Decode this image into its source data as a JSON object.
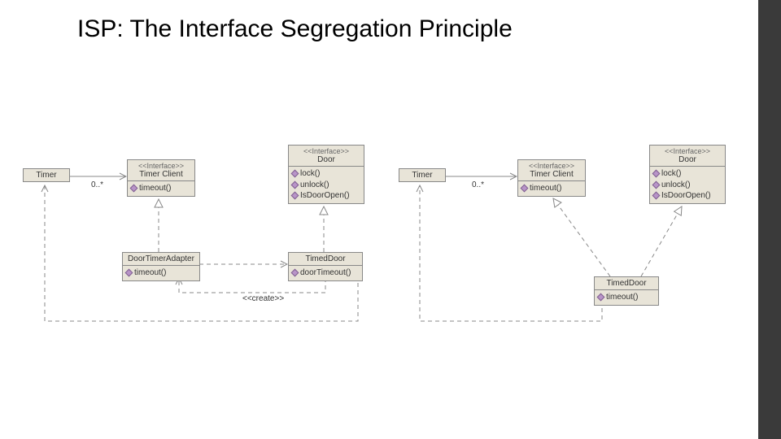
{
  "slide": {
    "title": "ISP: The Interface Segregation Principle"
  },
  "labels": {
    "mult_left": "0..*",
    "mult_right": "0..*",
    "create": "<<create>>"
  },
  "boxes": {
    "timer_l": {
      "name": "Timer"
    },
    "timerclient_l": {
      "stereo": "<<Interface>>",
      "name": "Timer Client",
      "m1": "timeout()"
    },
    "door_l": {
      "stereo": "<<Interface>>",
      "name": "Door",
      "m1": "lock()",
      "m2": "unlock()",
      "m3": "IsDoorOpen()"
    },
    "adapter": {
      "name": "DoorTimerAdapter",
      "m1": "timeout()"
    },
    "timeddoor_l": {
      "name": "TimedDoor",
      "m1": "doorTimeout()"
    },
    "timer_r": {
      "name": "Timer"
    },
    "timerclient_r": {
      "stereo": "<<Interface>>",
      "name": "Timer Client",
      "m1": "timeout()"
    },
    "door_r": {
      "stereo": "<<Interface>>",
      "name": "Door",
      "m1": "lock()",
      "m2": "unlock()",
      "m3": "IsDoorOpen()"
    },
    "timeddoor_r": {
      "name": "TimedDoor",
      "m1": "timeout()"
    }
  }
}
